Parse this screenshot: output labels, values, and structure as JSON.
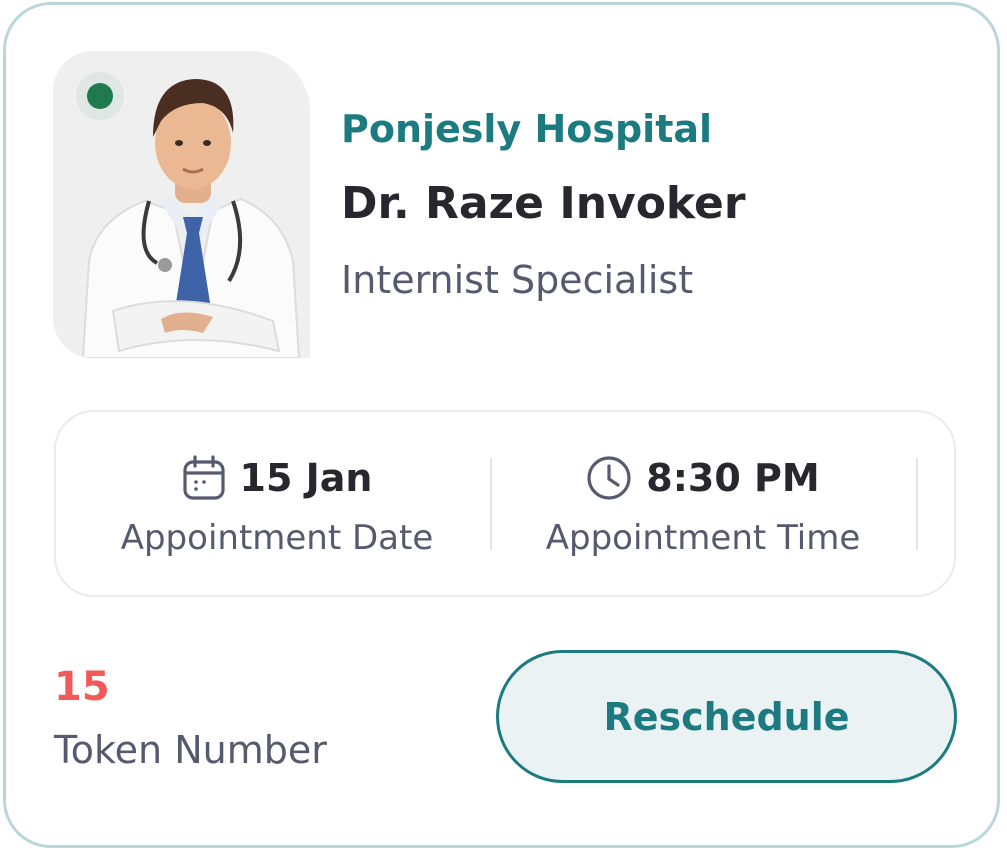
{
  "doctor_card": {
    "hospital": "Ponjesly Hospital",
    "doctor_name": "Dr. Raze Invoker",
    "specialty": "Internist Specialist",
    "photo_icon": "doctor-portrait",
    "status": "online"
  },
  "appointment": {
    "date_value": "15 Jan",
    "date_label": "Appointment Date",
    "date_icon": "calendar-icon",
    "time_value": "8:30 PM",
    "time_label": "Appointment Time",
    "time_icon": "clock-icon"
  },
  "token": {
    "value": "15",
    "label": "Token Number"
  },
  "actions": {
    "reschedule_label": "Reschedule"
  },
  "colors": {
    "accent": "#1b7b80",
    "token": "#f25a5a",
    "status_online": "#1f7a4d",
    "border": "#b9d7db"
  }
}
